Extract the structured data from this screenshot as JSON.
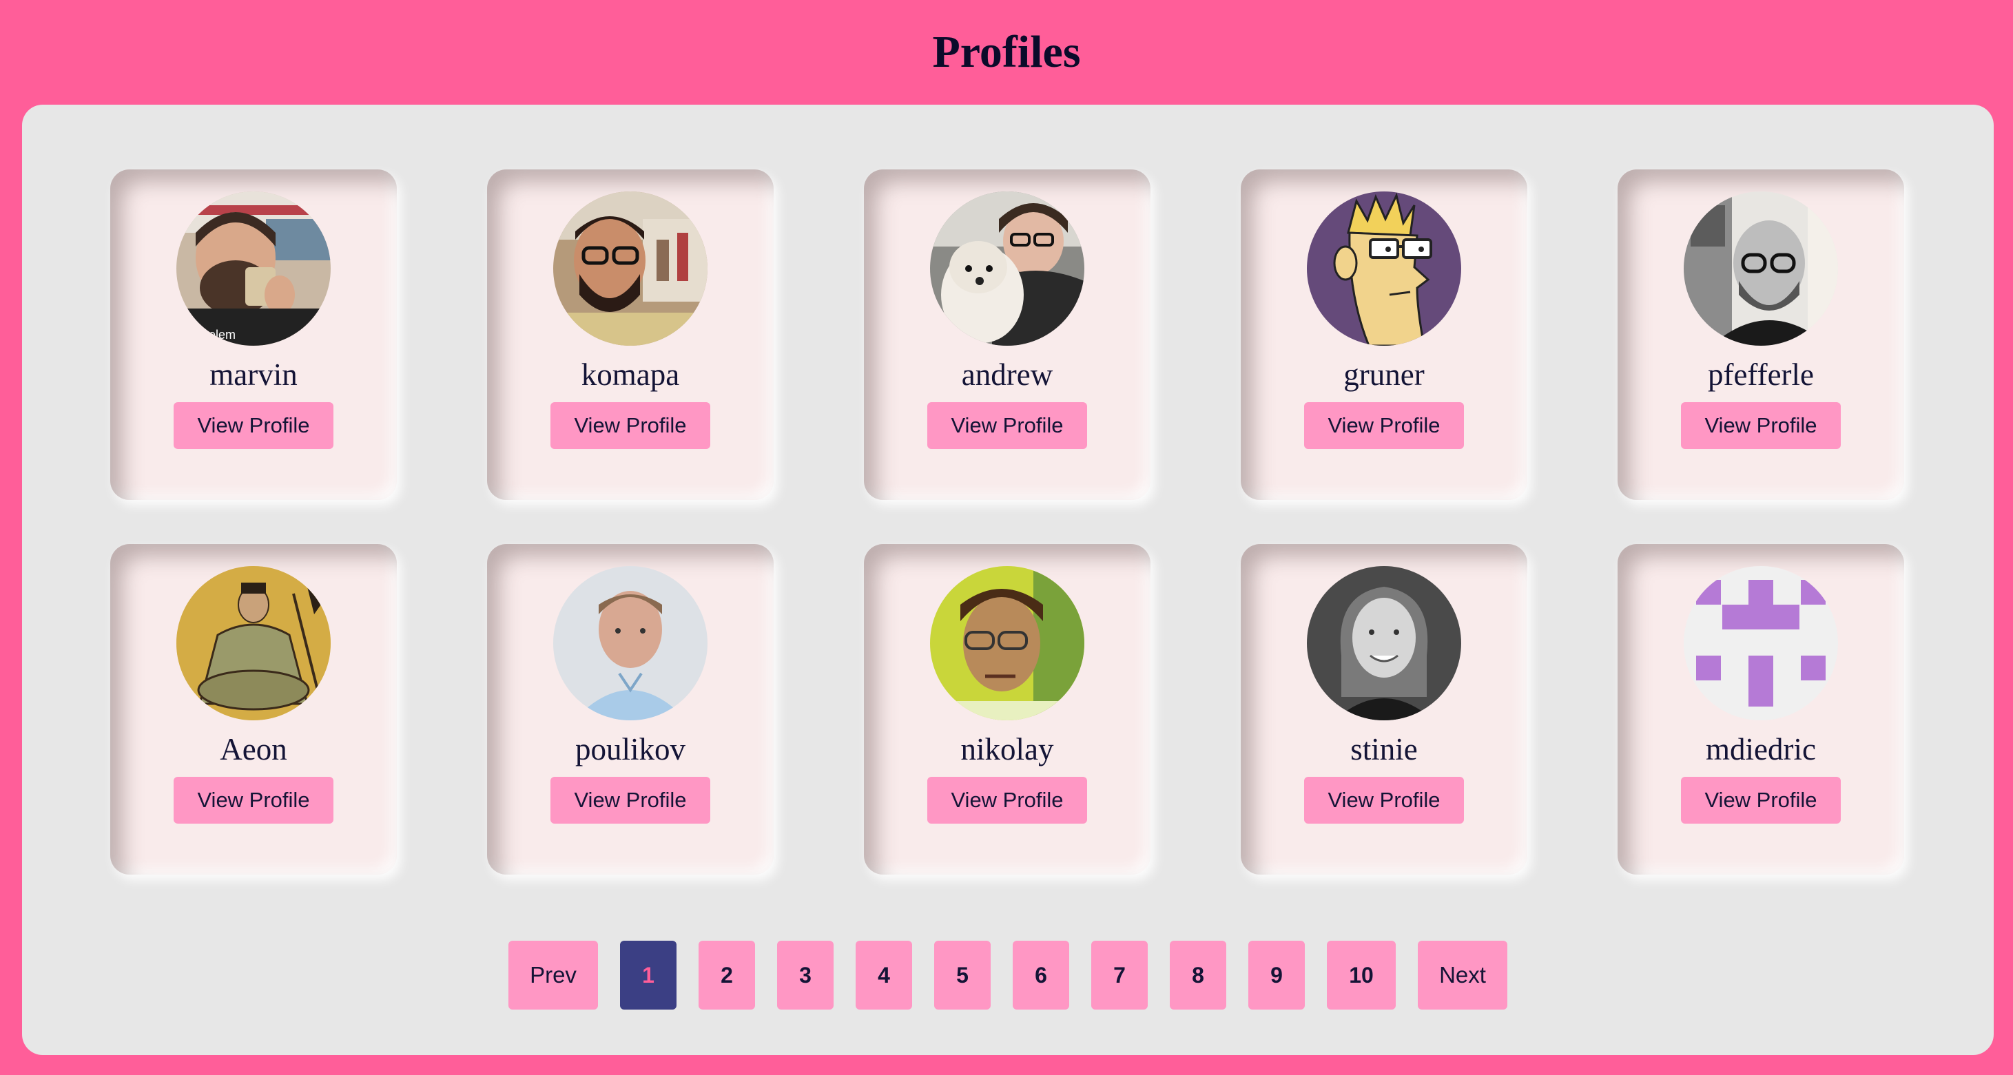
{
  "page": {
    "title": "Profiles"
  },
  "profiles": [
    {
      "username": "marvin",
      "button_label": "View Profile",
      "avatar_icon": "photo-man-drinking"
    },
    {
      "username": "komapa",
      "button_label": "View Profile",
      "avatar_icon": "photo-man-glasses-selfie"
    },
    {
      "username": "andrew",
      "button_label": "View Profile",
      "avatar_icon": "photo-man-with-dog"
    },
    {
      "username": "gruner",
      "button_label": "View Profile",
      "avatar_icon": "cartoon-man-glasses"
    },
    {
      "username": "pfefferle",
      "button_label": "View Profile",
      "avatar_icon": "photo-bald-man-glasses"
    },
    {
      "username": "Aeon",
      "button_label": "View Profile",
      "avatar_icon": "painting-seated-monk"
    },
    {
      "username": "poulikov",
      "button_label": "View Profile",
      "avatar_icon": "photo-man-blue-shirt"
    },
    {
      "username": "nikolay",
      "button_label": "View Profile",
      "avatar_icon": "photo-man-glasses-green"
    },
    {
      "username": "stinie",
      "button_label": "View Profile",
      "avatar_icon": "photo-woman-bw"
    },
    {
      "username": "mdiedric",
      "button_label": "View Profile",
      "avatar_icon": "identicon-purple"
    }
  ],
  "pagination": {
    "prev_label": "Prev",
    "next_label": "Next",
    "pages": [
      "1",
      "2",
      "3",
      "4",
      "5",
      "6",
      "7",
      "8",
      "9",
      "10"
    ],
    "current": "1"
  },
  "colors": {
    "background": "#ff5e99",
    "panel": "#e7e7e7",
    "card": "#f9ebeb",
    "button": "#ff97c4",
    "active_page": "#3b3f84",
    "text": "#141436"
  }
}
